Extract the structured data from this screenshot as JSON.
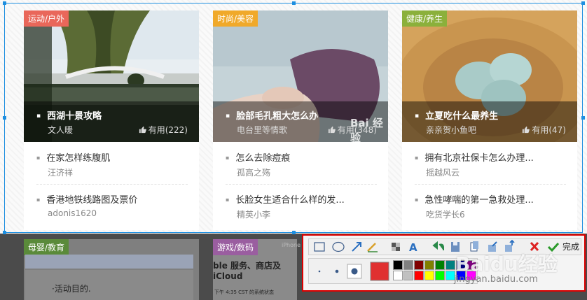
{
  "cards": [
    {
      "tag": "运动/户外",
      "tag_color": "#e9675a",
      "photo_title": "西湖十景攻略",
      "photo_author": "文人暖",
      "photo_useful": "有用(222)",
      "items": [
        {
          "title": "在家怎样练腹肌",
          "author": "汪济祥"
        },
        {
          "title": "香港地铁线路图及票价",
          "author": "adonis1620"
        }
      ]
    },
    {
      "tag": "时尚/美容",
      "tag_color": "#f0a92a",
      "photo_title": "脸部毛孔粗大怎么办",
      "photo_author": "电台里等情歌",
      "photo_useful": "有用(348)",
      "items": [
        {
          "title": "怎么去除痘痕",
          "author": "孤高之殇"
        },
        {
          "title": "长脸女生适合什么样的发...",
          "author": "精英小李"
        }
      ]
    },
    {
      "tag": "健康/养生",
      "tag_color": "#8bb03b",
      "photo_title": "立夏吃什么最养生",
      "photo_author": "亲亲贺小鱼吧",
      "photo_useful": "有用(47)",
      "items": [
        {
          "title": "拥有北京社保卡怎么办理...",
          "author": "摇越风云"
        },
        {
          "title": "急性哮喘的第一急救处理...",
          "author": "吃货学长6"
        }
      ]
    }
  ],
  "dimmed": {
    "tag_left": "母婴/教育",
    "tag_mid": "游戏/数码",
    "text_activity": "·活动目的.",
    "text_iphone": "iPhone",
    "text_service": "ble 服务、商店及 iCloud",
    "text_time": "下午 4:35 CST 的系统状态"
  },
  "toolbar": {
    "done_label": "完成",
    "colors": {
      "selected": "#e03030",
      "palette": [
        "#000000",
        "#808080",
        "#800000",
        "#808000",
        "#008000",
        "#008080",
        "#000080",
        "#800080",
        "#ffffff",
        "#c0c0c0",
        "#ff0000",
        "#ffff00",
        "#00ff00",
        "#00ffff",
        "#0000ff",
        "#ff00ff"
      ]
    }
  },
  "watermarks": {
    "baidu_big": "Baidu经验",
    "baidu_url": "jingyan.baidu.com",
    "baidu_small": "Bai 经验"
  }
}
